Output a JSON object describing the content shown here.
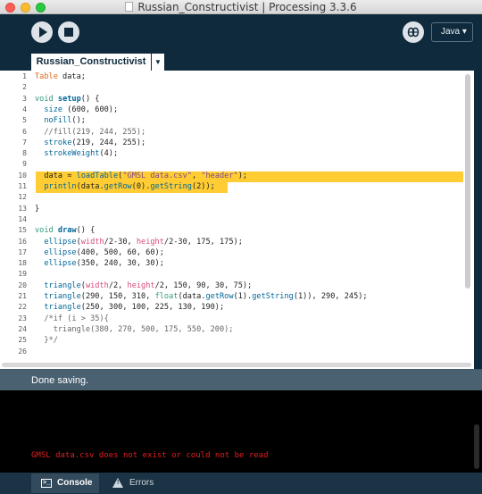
{
  "window": {
    "title": "Russian_Constructivist | Processing 3.3.6"
  },
  "toolbar": {
    "run_icon": "play-icon",
    "stop_icon": "stop-icon",
    "debug_icon": "debugger-icon",
    "mode_label": "Java ▾"
  },
  "tabs": {
    "active": "Russian_Constructivist",
    "menu_glyph": "▼"
  },
  "editor": {
    "highlight_color": "#ffcc33",
    "lines": [
      "Table data;",
      "",
      "void setup() {",
      "  size (600, 600);",
      "  noFill();",
      "  //fill(219, 244, 255);",
      "  stroke(219, 244, 255);",
      "  strokeWeight(4);",
      "",
      "  data = loadTable(\"GMSL data.csv\", \"header\");",
      "  println(data.getRow(0).getString(2));",
      "",
      "}",
      "",
      "void draw() {",
      "  ellipse(width/2-30, height/2-30, 175, 175);",
      "  ellipse(400, 500, 60, 60);",
      "  ellipse(350, 240, 30, 30);",
      "",
      "  triangle(width/2, height/2, 150, 90, 30, 75);",
      "  triangle(290, 150, 310, float(data.getRow(1).getString(1)), 290, 245);",
      "  triangle(250, 300, 100, 225, 130, 190);",
      "  /*if (i > 35){",
      "    triangle(380, 270, 500, 175, 550, 200);",
      "  }*/",
      ""
    ],
    "line_numbers": [
      "1",
      "2",
      "3",
      "4",
      "5",
      "6",
      "7",
      "8",
      "9",
      "10",
      "11",
      "12",
      "13",
      "14",
      "15",
      "16",
      "17",
      "18",
      "19",
      "20",
      "21",
      "22",
      "23",
      "24",
      "25",
      "26"
    ]
  },
  "status": {
    "message": "Done saving."
  },
  "console": {
    "error_text": "GMSL data.csv does not exist or could not be read",
    "error_color": "#e02020"
  },
  "bottom_tabs": {
    "console_label": "Console",
    "errors_label": "Errors"
  }
}
